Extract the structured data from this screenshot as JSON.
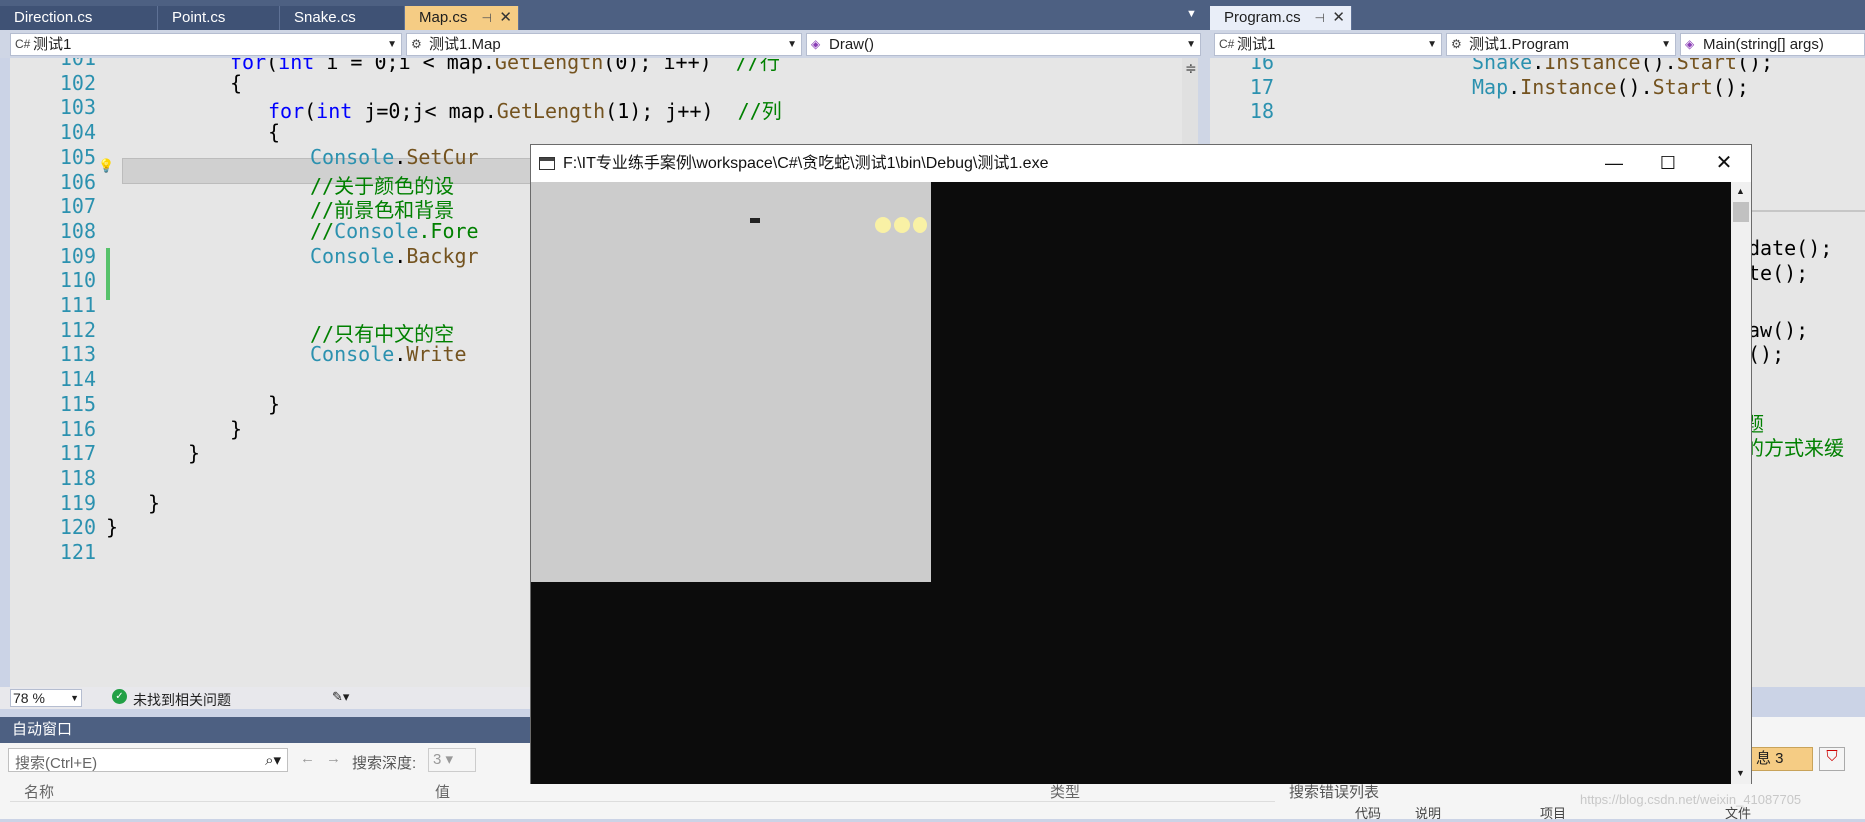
{
  "left_tabs": [
    "Direction.cs",
    "Point.cs",
    "Snake.cs",
    "Map.cs"
  ],
  "right_tabs": [
    "Program.cs"
  ],
  "left_nav": {
    "project": "测试1",
    "class": "测试1.Map",
    "member": "Draw()"
  },
  "right_nav": {
    "project": "测试1",
    "class": "测试1.Program",
    "member": "Main(string[] args)"
  },
  "left_code": [
    {
      "n": "101",
      "t": "for(int i = 0;i < map.GetLength(0); i++)  //行"
    },
    {
      "n": "102",
      "t": "{"
    },
    {
      "n": "103",
      "t": "for(int j=0;j< map.GetLength(1); j++)  //列"
    },
    {
      "n": "104",
      "t": "{"
    },
    {
      "n": "105",
      "t": "Console.SetCur"
    },
    {
      "n": "106",
      "t": "//关于颜色的设"
    },
    {
      "n": "107",
      "t": "//前景色和背景"
    },
    {
      "n": "108",
      "t": "//Console.Fore"
    },
    {
      "n": "109",
      "t": "Console.Backgr"
    },
    {
      "n": "110",
      "t": ""
    },
    {
      "n": "111",
      "t": ""
    },
    {
      "n": "112",
      "t": "//只有中文的空"
    },
    {
      "n": "113",
      "t": "Console.Write"
    },
    {
      "n": "114",
      "t": ""
    },
    {
      "n": "115",
      "t": "}"
    },
    {
      "n": "116",
      "t": "}"
    },
    {
      "n": "117",
      "t": "}"
    },
    {
      "n": "118",
      "t": ""
    },
    {
      "n": "119",
      "t": "}"
    },
    {
      "n": "120",
      "t": "}"
    },
    {
      "n": "121",
      "t": ""
    }
  ],
  "right_code": [
    {
      "n": "16",
      "t": "Snake.Instance().Start();"
    },
    {
      "n": "17",
      "t": "Map.Instance().Start();"
    },
    {
      "n": "18",
      "t": ""
    }
  ],
  "right_partial": [
    "date();",
    "te();",
    "aw();",
    "();",
    "题",
    "的方式来缓"
  ],
  "status": {
    "zoom": "78 %",
    "issues": "未找到相关问题"
  },
  "auto_window": {
    "title": "自动窗口",
    "search_placeholder": "搜索(Ctrl+E)",
    "depth_label": "搜索深度:",
    "depth_value": "3",
    "col_name": "名称",
    "col_value": "值",
    "col_type": "类型"
  },
  "error_list": {
    "search": "搜索错误列表",
    "badge": "息 3",
    "col_code": "代码",
    "col_desc": "说明",
    "col_project": "项目",
    "col_file": "文件"
  },
  "console": {
    "title": "F:\\IT专业练手案例\\workspace\\C#\\贪吃蛇\\测试1\\bin\\Debug\\测试1.exe"
  },
  "watermark": "https://blog.csdn.net/weixin_41087705",
  "colors": {
    "tab_active": "#f5cc84",
    "tab_bar": "#4d6082",
    "console_bg": "#0c0c0c",
    "map_bg": "#cccccc",
    "snake": "#f9f1a5"
  }
}
